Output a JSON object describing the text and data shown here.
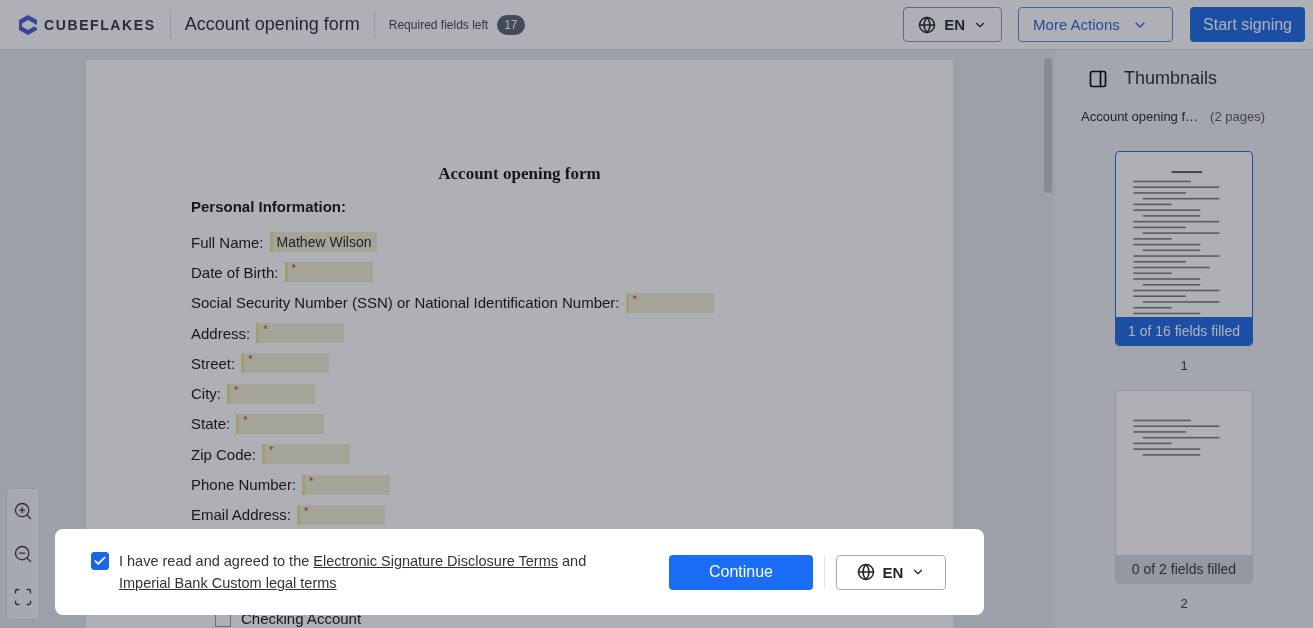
{
  "header": {
    "brand": "CUBEFLAKES",
    "title": "Account opening form",
    "required_label": "Required fields left",
    "required_count": "17",
    "language": "EN",
    "more_actions": "More Actions",
    "start_button": "Start signing"
  },
  "document": {
    "title": "Account opening form",
    "section": "Personal Information:",
    "fields": [
      {
        "label": "Full Name:",
        "value": "Mathew Wilson"
      },
      {
        "label": "Date of Birth:",
        "mark": "*"
      },
      {
        "label": "Social Security Number (SSN) or National Identification Number:",
        "mark": "*"
      },
      {
        "label": "Address:",
        "mark": "*"
      },
      {
        "label": "Street:",
        "mark": "*"
      },
      {
        "label": "City:",
        "mark": "*"
      },
      {
        "label": "State:",
        "mark": "*"
      },
      {
        "label": "Zip Code:",
        "mark": "*"
      },
      {
        "label": "Phone Number:",
        "mark": "*"
      },
      {
        "label": "Email Address:",
        "mark": "*"
      }
    ],
    "options": [
      {
        "label": "Checking Account",
        "checked": false
      }
    ]
  },
  "thumbnails": {
    "title": "Thumbnails",
    "file_name": "Account opening f…",
    "page_count": "(2 pages)",
    "pages": [
      {
        "status": "1 of 16 fields filled",
        "number": "1",
        "selected": true
      },
      {
        "status": "0 of 2 fields filled",
        "number": "2",
        "selected": false
      }
    ]
  },
  "consent": {
    "checked": true,
    "parts": [
      {
        "kind": "text",
        "text": "I have read and agreed to the "
      },
      {
        "kind": "link",
        "text": "Electronic Signature Disclosure Terms"
      },
      {
        "kind": "text",
        "text": " and "
      },
      {
        "kind": "link",
        "text": "Imperial Bank Custom legal terms"
      }
    ],
    "continue_button": "Continue",
    "language": "EN"
  }
}
